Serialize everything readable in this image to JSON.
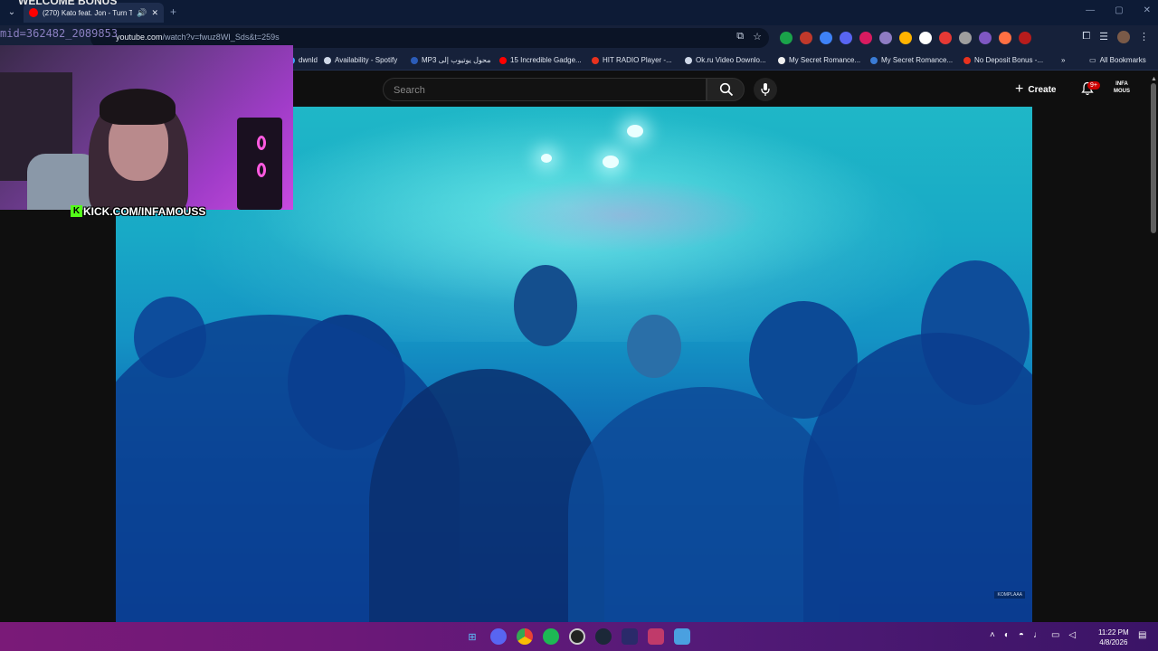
{
  "overlay": {
    "welcome_text": "WELCOME BONUS",
    "mid_text": "mid=362482_2089853",
    "kick_text": "KICK.COM/INFAMOUSS",
    "kick_logo": "K"
  },
  "browser": {
    "tab": {
      "title": "(270) Kato feat. Jon - Turn T",
      "close": "✕",
      "speaker": "🔊"
    },
    "new_tab": "+",
    "tab_list": "⌄",
    "window_controls": [
      "—",
      "▢",
      "✕"
    ],
    "url_host": "youtube.com",
    "url_path": "/watch?v=fwuz8WI_Sds&t=259s",
    "bookmarks": [
      {
        "label": "dwnld",
        "color": "#3ea6ff"
      },
      {
        "label": "Availability - Spotify",
        "color": "#cfd8e8"
      },
      {
        "label": "MP3 محول يوتيوب إلى",
        "color": "#2b5cb8"
      },
      {
        "label": "15 Incredible Gadge...",
        "color": "#ff0000"
      },
      {
        "label": "HIT RADIO Player -...",
        "color": "#e8321e"
      },
      {
        "label": "Ok.ru Video Downlo...",
        "color": "#cfd8e8"
      },
      {
        "label": "My Secret Romance...",
        "color": "#f0f0f0"
      },
      {
        "label": "My Secret Romance...",
        "color": "#3a7bd5"
      },
      {
        "label": "No Deposit Bonus -...",
        "color": "#e8321e"
      }
    ],
    "bookmarks_more": "»",
    "all_bookmarks": "All Bookmarks"
  },
  "youtube": {
    "search_placeholder": "Search",
    "create_label": "Create",
    "notification_count": "9+",
    "channel_label": "INFA MOUS"
  },
  "video": {
    "watermark": "KOMPLAAA"
  },
  "taskbar": {
    "time": "11:22 PM",
    "date": "4/8/2026"
  },
  "colors": {
    "accent_red": "#ff0000",
    "kick_green": "#53fc18",
    "taskbar_start": "#7a1a78",
    "taskbar_end": "#3a1466"
  }
}
